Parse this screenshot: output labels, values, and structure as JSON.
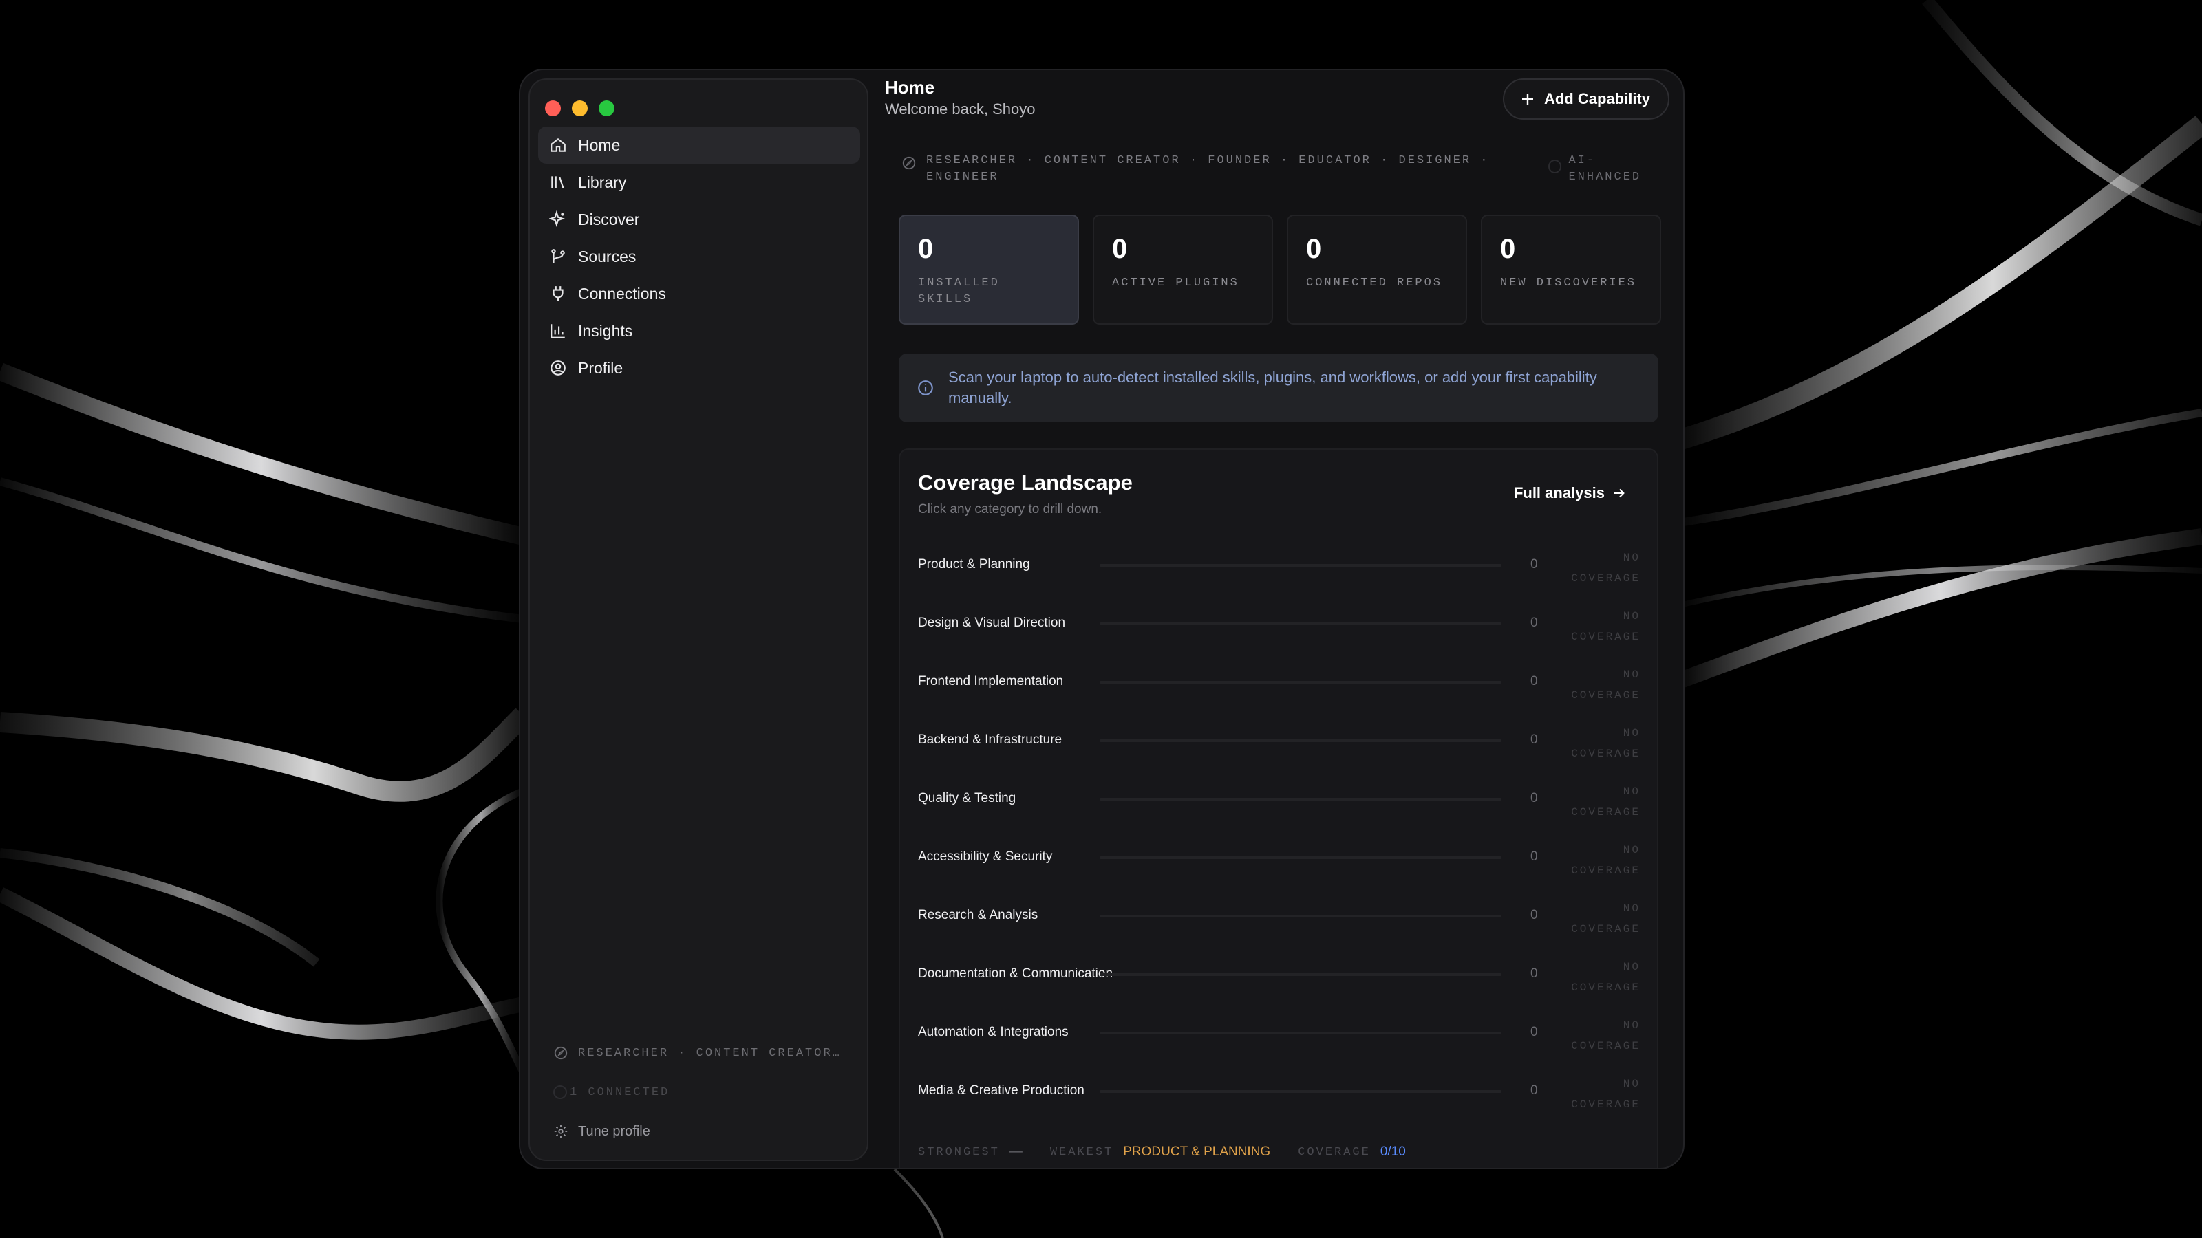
{
  "colors": {
    "accent": "#4a6ad0",
    "weakest": "#e0a24a",
    "coverage": "#5a8cff",
    "info_text": "#8fa4d4"
  },
  "sidebar": {
    "items": [
      {
        "label": "Home",
        "icon": "home-icon",
        "active": true
      },
      {
        "label": "Library",
        "icon": "library-icon"
      },
      {
        "label": "Discover",
        "icon": "sparkles-icon"
      },
      {
        "label": "Sources",
        "icon": "git-branch-icon"
      },
      {
        "label": "Connections",
        "icon": "plug-icon"
      },
      {
        "label": "Insights",
        "icon": "bar-chart-icon"
      },
      {
        "label": "Profile",
        "icon": "user-circle-icon"
      }
    ],
    "footer": {
      "roles": "RESEARCHER · CONTENT CREATOR…",
      "connected": "1 CONNECTED",
      "tune": "Tune profile"
    }
  },
  "header": {
    "title": "Home",
    "subtitle": "Welcome back, Shoyo",
    "add_button": "Add Capability"
  },
  "roles": {
    "text": "RESEARCHER · CONTENT CREATOR · FOUNDER · EDUCATOR · DESIGNER · ENGINEER",
    "badge": "AI-ENHANCED"
  },
  "stats": [
    {
      "value": "0",
      "label": "INSTALLED SKILLS"
    },
    {
      "value": "0",
      "label": "ACTIVE PLUGINS"
    },
    {
      "value": "0",
      "label": "CONNECTED REPOS"
    },
    {
      "value": "0",
      "label": "NEW DISCOVERIES"
    }
  ],
  "info": {
    "text": "Scan your laptop to auto-detect installed skills, plugins, and workflows, or add your first capability manually."
  },
  "coverage": {
    "title": "Coverage Landscape",
    "subtitle": "Click any category to drill down.",
    "full_link": "Full analysis",
    "rows": [
      {
        "name": "Product & Planning",
        "count": "0",
        "level": 0,
        "status": "NO COVERAGE"
      },
      {
        "name": "Design & Visual Direction",
        "count": "0",
        "level": 0,
        "status": "NO COVERAGE"
      },
      {
        "name": "Frontend Implementation",
        "count": "0",
        "level": 0,
        "status": "NO COVERAGE"
      },
      {
        "name": "Backend & Infrastructure",
        "count": "0",
        "level": 0,
        "status": "NO COVERAGE"
      },
      {
        "name": "Quality & Testing",
        "count": "0",
        "level": 0,
        "status": "NO COVERAGE"
      },
      {
        "name": "Accessibility & Security",
        "count": "0",
        "level": 0,
        "status": "NO COVERAGE"
      },
      {
        "name": "Research & Analysis",
        "count": "0",
        "level": 0,
        "status": "NO COVERAGE"
      },
      {
        "name": "Documentation & Communication",
        "count": "0",
        "level": 0,
        "status": "NO COVERAGE"
      },
      {
        "name": "Automation & Integrations",
        "count": "0",
        "level": 0,
        "status": "NO COVERAGE"
      },
      {
        "name": "Media & Creative Production",
        "count": "0",
        "level": 0,
        "status": "NO COVERAGE"
      }
    ],
    "footer": {
      "strongest_label": "STRONGEST",
      "strongest_value": "—",
      "weakest_label": "WEAKEST",
      "weakest_value": "Product & Planning",
      "coverage_label": "COVERAGE",
      "coverage_value": "0/10"
    }
  }
}
